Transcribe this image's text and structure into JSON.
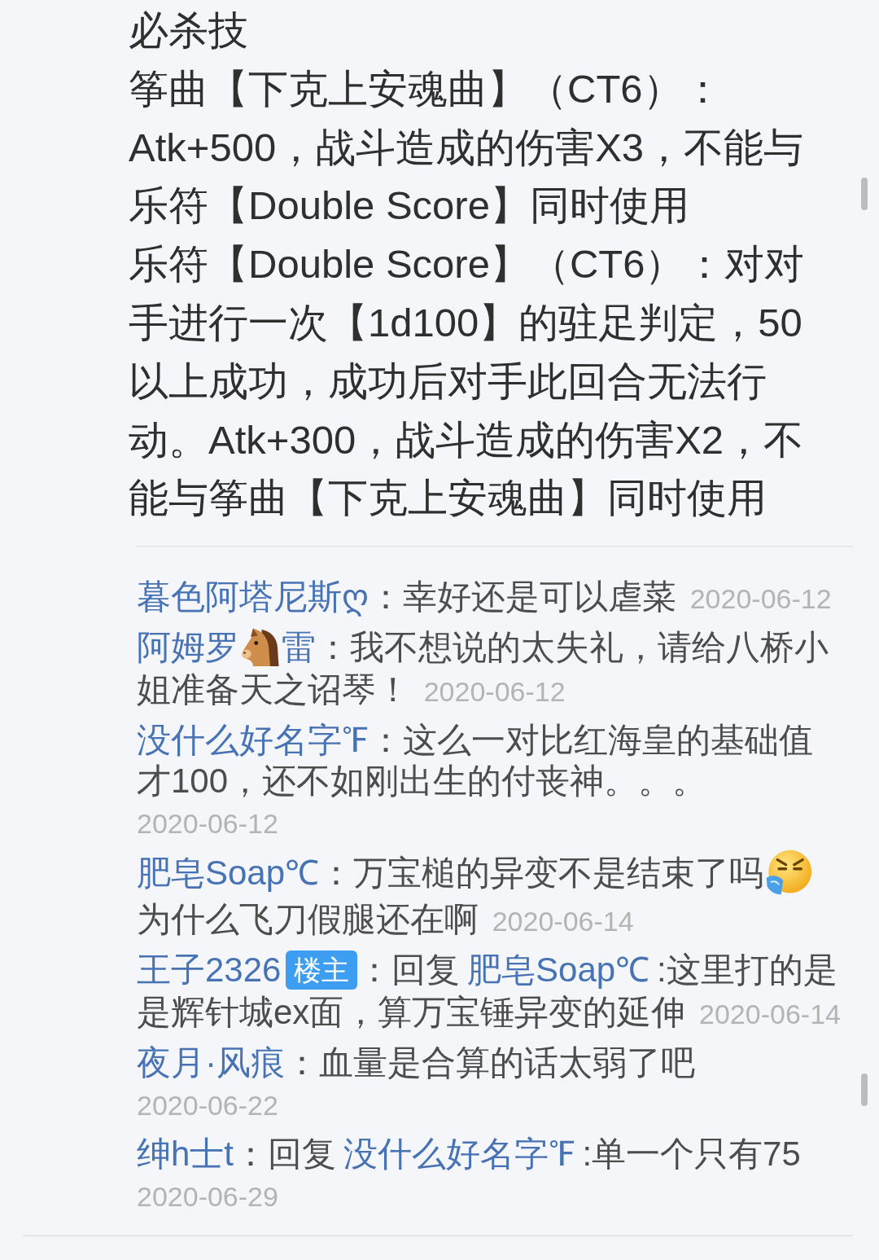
{
  "post": {
    "heading": "必杀技",
    "paragraphs": [
      "筝曲【下克上安魂曲】（CT6）：Atk+500，战斗造成的伤害X3，不能与乐符【Double Score】同时使用",
      "乐符【Double Score】（CT6）：对对手进行一次【1d100】的驻足判定，50以上成功，成功后对手此回合无法行动。Atk+300，战斗造成的伤害X2，不能与筝曲【下克上安魂曲】同时使用"
    ]
  },
  "comments": [
    {
      "author": [
        {
          "kind": "text",
          "text": "暮色阿塔尼斯ღ"
        }
      ],
      "colon": "：",
      "body": [
        {
          "kind": "text",
          "text": "幸好还是可以虐菜"
        }
      ],
      "date": "2020-06-12"
    },
    {
      "author": [
        {
          "kind": "text",
          "text": "阿姆罗"
        },
        {
          "kind": "horse"
        },
        {
          "kind": "text",
          "text": "雷"
        }
      ],
      "colon": "：",
      "body": [
        {
          "kind": "text",
          "text": "我不想说的太失礼，请给八桥小姐准备天之诏琴！"
        }
      ],
      "date": "2020-06-12"
    },
    {
      "author": [
        {
          "kind": "text",
          "text": "没什么好名字℉"
        }
      ],
      "colon": "：",
      "body": [
        {
          "kind": "text",
          "text": "这么一对比红海皇的基础值才100，还不如刚出生的付丧神。。。"
        }
      ],
      "date": "2020-06-12"
    },
    {
      "author": [
        {
          "kind": "text",
          "text": "肥皂Soap℃"
        }
      ],
      "colon": "：",
      "body": [
        {
          "kind": "text",
          "text": "万宝槌的异变不是结束了吗"
        },
        {
          "kind": "face"
        },
        {
          "kind": "text",
          "text": "为什么飞刀假腿还在啊"
        }
      ],
      "date": "2020-06-14"
    },
    {
      "author": [
        {
          "kind": "text",
          "text": "王子2326"
        }
      ],
      "badge": "楼主",
      "colon": "：",
      "reply": {
        "label": "回复",
        "user": "肥皂Soap℃"
      },
      "body": [
        {
          "kind": "text",
          "text": ":这里打的是是辉针城ex面，算万宝锤异变的延伸"
        }
      ],
      "date": "2020-06-14"
    },
    {
      "author": [
        {
          "kind": "text",
          "text": "夜月·风痕"
        }
      ],
      "colon": "：",
      "body": [
        {
          "kind": "text",
          "text": "血量是合算的话太弱了吧"
        }
      ],
      "date": "2020-06-22"
    },
    {
      "author": [
        {
          "kind": "text",
          "text": "绅h士t"
        }
      ],
      "colon": "：",
      "reply": {
        "label": "回复",
        "user": "没什么好名字℉"
      },
      "body": [
        {
          "kind": "text",
          "text": ":单一个只有75"
        }
      ],
      "date": "2020-06-29"
    }
  ]
}
